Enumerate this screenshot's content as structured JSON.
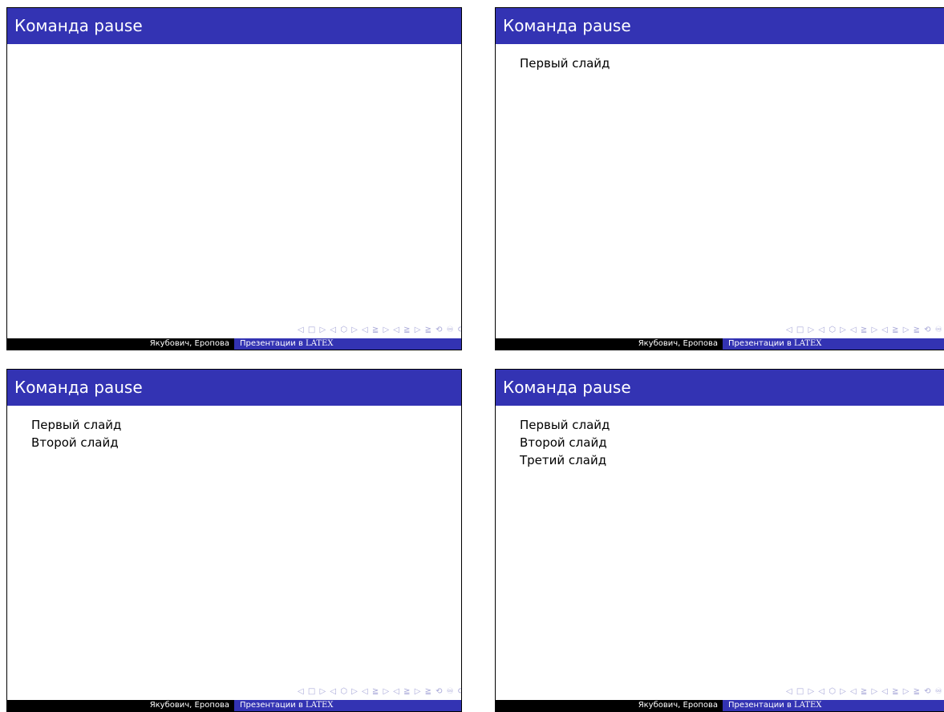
{
  "slides": [
    {
      "title": "Команда pause",
      "lines": [],
      "footer": {
        "authors": "Якубович, Еропова",
        "presentation_prefix": "Презентации в ",
        "latex": "LATEX"
      },
      "nav": "◁ □ ▷ ◁ ⬡ ▷ ◁ ≧ ▷ ◁ ≧ ▷  ≧  ⟲ ♾ ⟳"
    },
    {
      "title": "Команда pause",
      "lines": [
        "Первый слайд"
      ],
      "footer": {
        "authors": "Якубович, Еропова",
        "presentation_prefix": "Презентации в ",
        "latex": "LATEX"
      },
      "nav": "◁ □ ▷ ◁ ⬡ ▷ ◁ ≧ ▷ ◁ ≧ ▷  ≧  ⟲ ♾ ⟳"
    },
    {
      "title": "Команда pause",
      "lines": [
        "Первый слайд",
        "Второй слайд"
      ],
      "footer": {
        "authors": "Якубович, Еропова",
        "presentation_prefix": "Презентации в ",
        "latex": "LATEX"
      },
      "nav": "◁ □ ▷ ◁ ⬡ ▷ ◁ ≧ ▷ ◁ ≧ ▷  ≧  ⟲ ♾ ⟳"
    },
    {
      "title": "Команда pause",
      "lines": [
        "Первый слайд",
        "Второй слайд",
        "Третий слайд"
      ],
      "footer": {
        "authors": "Якубович, Еропова",
        "presentation_prefix": "Презентации в ",
        "latex": "LATEX"
      },
      "nav": "◁ □ ▷ ◁ ⬡ ▷ ◁ ≧ ▷ ◁ ≧ ▷  ≧  ⟲ ♾ ⟳"
    }
  ],
  "colors": {
    "title_bar": "#3333b3",
    "footer_left": "#000000",
    "footer_right": "#3333b3",
    "nav_symbols": "#a8a8d8"
  }
}
